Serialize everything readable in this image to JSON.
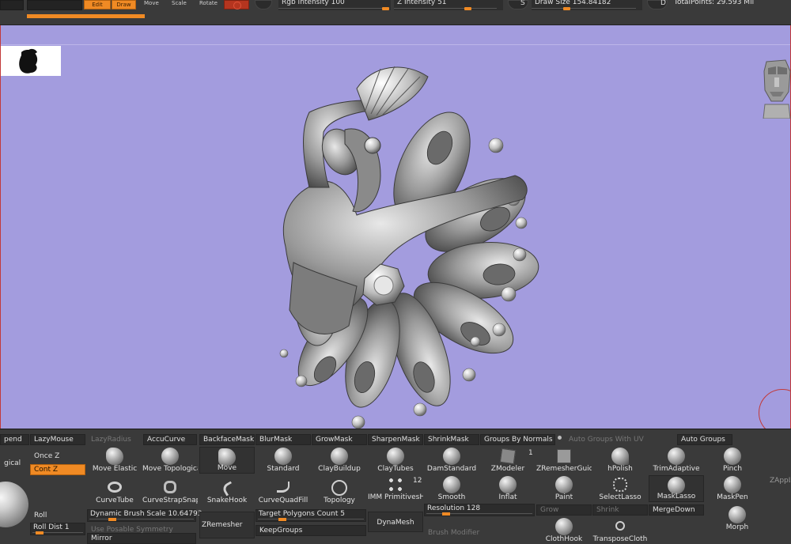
{
  "topbar": {
    "edit_label": "Edit",
    "draw_label": "Draw",
    "move_label": "Move",
    "scale_label": "Scale",
    "rotate_label": "Rotate",
    "rgb_intensity_label": "Rgb Intensity",
    "rgb_intensity_value": "100",
    "z_intensity_label": "Z Intensity",
    "z_intensity_value": "51",
    "s_label": "S",
    "draw_size_label": "Draw Size",
    "draw_size_value": "154.84182",
    "d_label": "D",
    "total_points": "TotalPoints: 29.593 Mil"
  },
  "colors": {
    "accent": "#f08a24",
    "canvas": "#a39cde",
    "panel": "#3a3a3a"
  },
  "shelf": {
    "row1": {
      "append": "pend",
      "lazy_mouse": "LazyMouse",
      "lazy_radius": "LazyRadius",
      "accu_curve": "AccuCurve",
      "backface_mask": "BackfaceMask",
      "blur_mask": "BlurMask",
      "grow_mask": "GrowMask",
      "sharpen_mask": "SharpenMask",
      "shrink_mask": "ShrinkMask",
      "groups_by_normals": "Groups By Normals",
      "auto_groups_with_uv": "Auto Groups With UV",
      "auto_groups": "Auto Groups"
    },
    "left": {
      "logical": "gical",
      "once_z": "Once Z",
      "cont_z": "Cont Z",
      "roll": "Roll",
      "roll_dist_label": "Roll Dist",
      "roll_dist_value": "1"
    },
    "brushes_row1": {
      "move_elastic": "Move Elastic",
      "move_topological": "Move Topological",
      "move": "Move",
      "standard": "Standard",
      "clay_buildup": "ClayBuildup",
      "clay_tubes": "ClayTubes",
      "dam_standard": "DamStandard",
      "zmodeler": "ZModeler",
      "zmodeler_count": "1",
      "zremesher_guide": "ZRemesherGuide",
      "hpolish": "hPolish",
      "trim_adaptive": "TrimAdaptive",
      "pinch": "Pinch"
    },
    "brushes_row2": {
      "curve_tube": "CurveTube",
      "curve_strap_snap": "CurveStrapSnap",
      "snake_hook": "SnakeHook",
      "curve_quad_fill": "CurveQuadFill",
      "topology": "Topology",
      "imm_primitives": "IMM PrimitivesH",
      "imm_count": "12",
      "smooth": "Smooth",
      "inflat": "Inflat",
      "paint": "Paint",
      "select_lasso": "SelectLasso",
      "mask_lasso": "MaskLasso",
      "mask_pen": "MaskPen",
      "zapplink": "ZAppLi"
    },
    "bottom": {
      "dynamic_brush_scale_label": "Dynamic Brush Scale",
      "dynamic_brush_scale_value": "10.64793",
      "use_posable_symmetry": "Use Posable Symmetry",
      "mirror": "Mirror",
      "zremesher": "ZRemesher",
      "target_polygons_label": "Target Polygons Count",
      "target_polygons_value": "5",
      "keep_groups": "KeepGroups",
      "dynamesh": "DynaMesh",
      "resolution_label": "Resolution",
      "resolution_value": "128",
      "brush_modifier": "Brush Modifier",
      "grow": "Grow",
      "shrink": "Shrink",
      "merge_down": "MergeDown",
      "cloth_hook": "ClothHook",
      "transpose_cloth": "TransposeCloth",
      "morph": "Morph"
    }
  }
}
